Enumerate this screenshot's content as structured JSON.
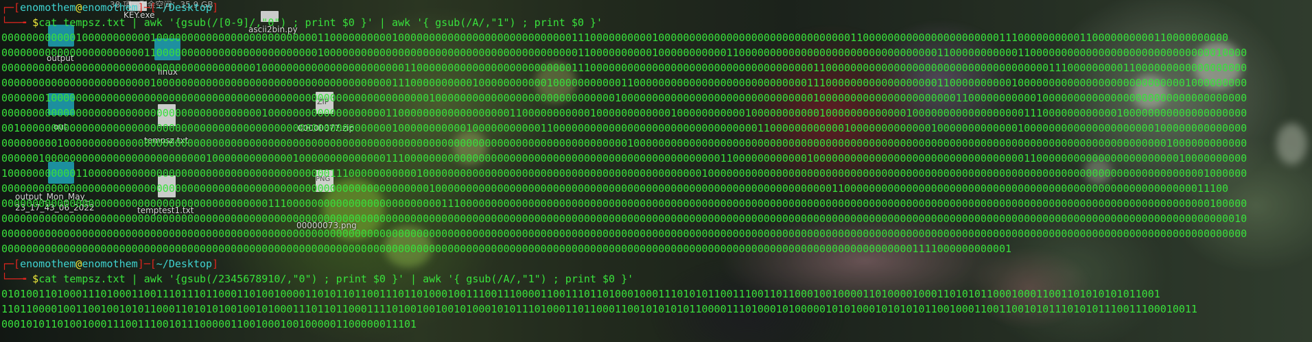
{
  "prompt": {
    "bracket_open": "┌─[",
    "user": "enomothem",
    "at": "@",
    "host": "enomothem",
    "sep": "]─[",
    "dir": "~/Desktop",
    "bracket_close": "]",
    "input_prefix": "└──╼ ",
    "dollar": "$"
  },
  "commands": {
    "first": "cat tempsz.txt | awk '{gsub(/[0-9]/,\"0\") ; print $0 }' | awk '{ gsub(/A/,\"1\") ; print $0 }'",
    "second": "cat tempsz.txt | awk '{gsub(/2345678910/,\"0\") ; print $0 }' | awk '{ gsub(/A/,\"1\") ; print $0 }'"
  },
  "output_first": [
    "000000000000100000000000100000000000000000000000000110000000000100000000000000000000000000001110000000000100000000000000000000000000000001100000000000000000000001110000000000110000000000110000000000",
    "000000000000000000000001100000000000000000000000000100000000000000000000000000000000000000000110000000000100000000000110000000000000000000000000000000011000000000001100000000000000000000000000000010000",
    "000000000000000000000000000000000000000001000000000000000000000001100000000000000000000000001110000000000000000000000000000000000001100000000000000000000000000000000000011100000000011000000000000000000",
    "000000000000000000000000100000000000000000000000000000000000000111000000000010000000000010000000000011000000000000000000000000000011100000000000000000011000000000010000000000000000000000000001000000000",
    "000000010000000000000000000000000000000000000000000000000000000000000100000000000000000000000000000100000000000000000000000000000001000000000000000000000011000000000001000000000000000000000000000000000",
    "000000000000000000000000000000000000000000100000000000000000001100000000000000000011000000000001000000000000100000000000100000000000100000000000001000000000000000000111000000000000100000000000000000000",
    "001000000000000000000000000000000000000000000000000000000000000100000000000100000000000110000000000000000000000000000000001100000000000010000000000000100000000000001000000000000000000000100000000000000",
    "000000000100000000000000000000000000000000000000000000000000000000000000000000000000000000000000000001000000000000000000000000000000000000000000000000000000000000000000000000000000000000001000000000000",
    "000000100000000000000000000000000100000000000001000000000000001110000000000000000000000000000000000000000000000000001100000000000010000000000000000000000000000000000110000000000000000000000010000000000",
    "100000000000110000000000000000000000000000000000000001110000000000010000000000000000000000000000000000000000000001000000000000000000000000000000000000000000000000000000000000000000000000000000001000000",
    "000000000000000000000000000000000000000000000000000000000000000000000100000000000000000000000000000000000000000000000000000000000000001100000000000000000000000000000000000000000000000000000000011100",
    "000000000000000000000000000000000000000000011100000000000000000000000001110000000000000000000000000000000000000000000000000000000000000000000000000000000000000000000000000000000000000000000000000100000",
    "000000000000000000000000000000000000000000000000000000000000000000000000000000000000000000000000000000000000000000000000000000000000000000000000000000000000000000000000000000000000000000000000000000010",
    "000000000000000000000000000000000000000000000000000000000000000000000000000000000000000000000000000000000000000000000000000000000000000000000000000000000000000000000000000000000000000000000000000000000",
    "0000000000000000000000000000000000000000000000000000000000000000000000000000000000000000000000000000000000000000000000000000000000000000000000000001111000000000001"
  ],
  "output_second": [
    "0101001101000111010001100111011101100011010010000110101101100111011010001001110011100001100111011010001000111010101100111001101100010010000110100001000110101011000100011001101010101011001",
    "1101100001001100100101011000110101010010010100011101101100011110100100100101000101011101000110110001100101010101100001110100010100000101010001010101011001000110011001010111010101110011100010011",
    "0001010110100100011100111001011100000110010001001000001100000011101"
  ],
  "taskbar_ghost": "38 項 · 剩余空间：35.9 GB",
  "desktop_icons": [
    {
      "label": "KEY.exe"
    },
    {
      "label": "ascii2bin.py"
    },
    {
      "label": "output"
    },
    {
      "label": "linux"
    },
    {
      "label": "ZIP"
    },
    {
      "label": "out"
    },
    {
      "label": "tempsz.txt"
    },
    {
      "label": "00000077.zip"
    },
    {
      "label": "output_Mon_May_"
    },
    {
      "label": "23_17_43_06_2022"
    },
    {
      "label": "temptest1.txt"
    },
    {
      "label": "00000073.png"
    },
    {
      "label": "PNG"
    }
  ]
}
